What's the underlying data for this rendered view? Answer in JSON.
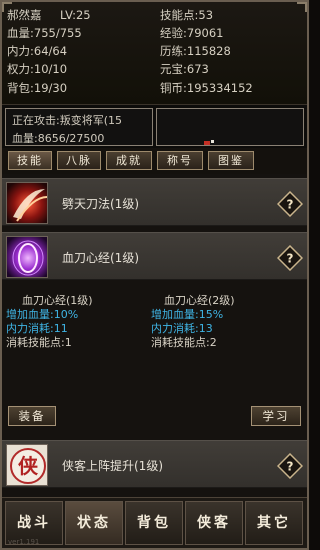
{
  "stats": {
    "name": "郝然嘉",
    "level": "LV:25",
    "skill_points": "技能点:53",
    "hp": "血量:755/755",
    "exp": "经验:79061",
    "mp": "内力:64/64",
    "history": "历练:115828",
    "power": "权力:10/10",
    "yuanbao": "元宝:673",
    "bag": "背包:19/30",
    "copper": "铜币:195334152"
  },
  "battle": {
    "attacking": "正在攻击:叛变将军(15",
    "enemy_hp": "血量:8656/27500"
  },
  "tabs": [
    {
      "label": "技能"
    },
    {
      "label": "八脉"
    },
    {
      "label": "成就"
    },
    {
      "label": "称号"
    },
    {
      "label": "图鉴"
    }
  ],
  "skills": [
    {
      "name": "劈天刀法(1级)",
      "icon": "blade-slash-icon"
    },
    {
      "name": "血刀心经(1级)",
      "icon": "purple-aura-icon"
    }
  ],
  "detail": {
    "current": {
      "title": "血刀心经(1级)",
      "bonus": "增加血量:10%",
      "mp_cost": "内力消耗:11",
      "sp_cost": "消耗技能点:1"
    },
    "next": {
      "title": "血刀心经(2级)",
      "bonus": "增加血量:15%",
      "mp_cost": "内力消耗:13",
      "sp_cost": "消耗技能点:2"
    },
    "equip_label": "装备",
    "learn_label": "学习"
  },
  "passive": {
    "name": "侠客上阵提升(1级)",
    "icon_char": "侠"
  },
  "nav": [
    {
      "label": "战斗"
    },
    {
      "label": "状态"
    },
    {
      "label": "背包"
    },
    {
      "label": "侠客"
    },
    {
      "label": "其它"
    }
  ],
  "version": "ver1.191",
  "colors": {
    "blue_text": "#3fb4e4",
    "panel": "#3a3632",
    "accent_red": "#c43025"
  }
}
